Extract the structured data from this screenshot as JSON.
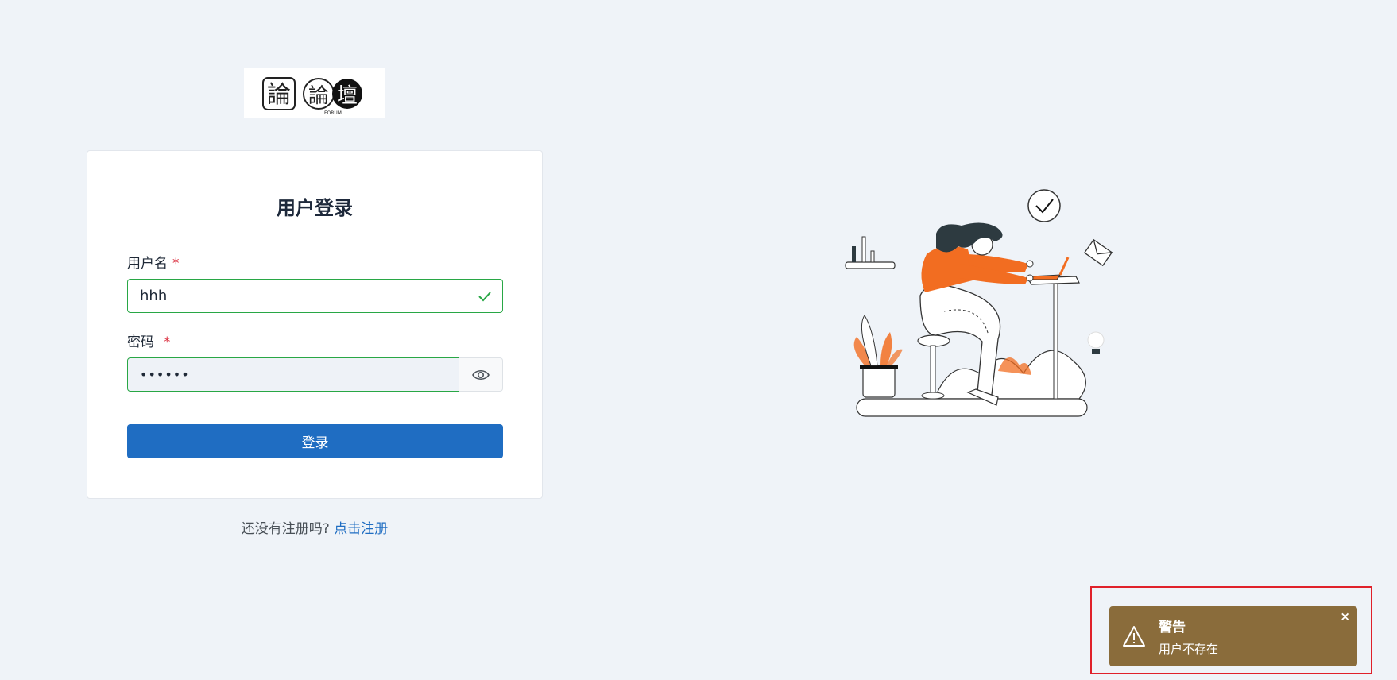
{
  "logo": {
    "text": "論 論壇",
    "subtext": "FORUM"
  },
  "login": {
    "title": "用户登录",
    "username_label": "用户名",
    "username_value": "hhh",
    "password_label": "密码",
    "password_value": "••••••",
    "required_mark": "*",
    "submit_label": "登录"
  },
  "register": {
    "prompt": "还没有注册吗?",
    "link": "点击注册"
  },
  "toast": {
    "title": "警告",
    "message": "用户不存在",
    "close": "×"
  },
  "colors": {
    "background": "#eff3f8",
    "primary": "#1f6dc2",
    "valid": "#28a745",
    "toast_bg": "#8a6c3b",
    "accent": "#f26d21"
  }
}
